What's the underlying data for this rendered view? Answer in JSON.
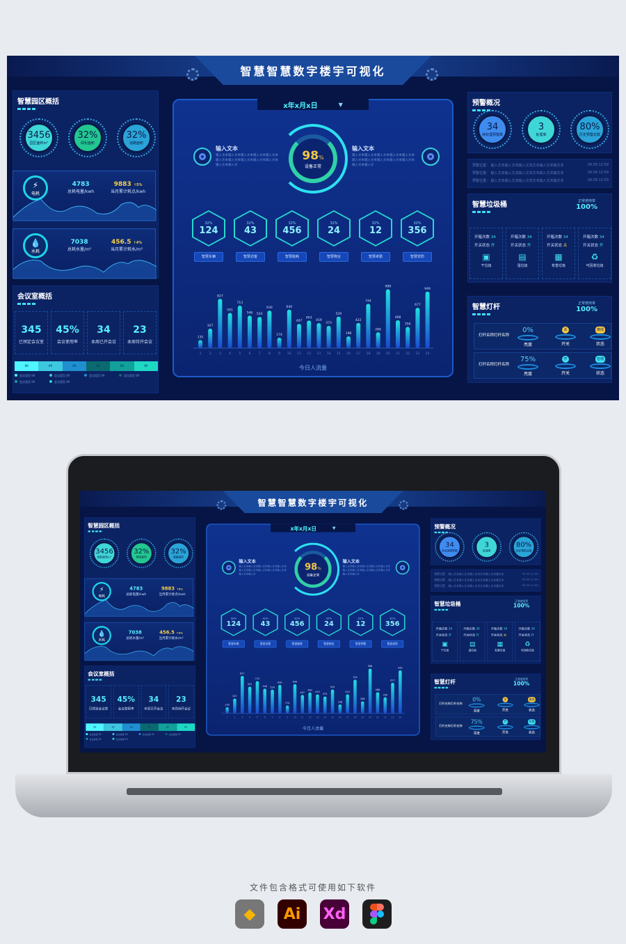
{
  "header": {
    "title": "智慧智慧数字楼宇可视化"
  },
  "park": {
    "title": "智慧园区概括",
    "circles": [
      {
        "value": "3456",
        "label": "园区面积m²",
        "color": "#3fd6d8"
      },
      {
        "value": "32%",
        "label": "绿化面积",
        "color": "#22c890"
      },
      {
        "value": "32%",
        "label": "道路面积",
        "color": "#2aa4d8"
      }
    ],
    "electric": {
      "icon_label": "电耗",
      "total": "4783",
      "total_label": "总耗电量/kwh",
      "month": "9883",
      "month_trend": "↑5%",
      "month_label": "当月累计耗点/kwh"
    },
    "water": {
      "icon_label": "水耗",
      "total": "7038",
      "total_label": "总耗水量/m²",
      "month": "456.5",
      "month_trend": "↑4%",
      "month_label": "当月累计耗水/m²"
    }
  },
  "meeting": {
    "title": "会议室概括",
    "stats": [
      {
        "value": "345",
        "label": "已预定会议室"
      },
      {
        "value": "45%",
        "label": "会议使用率"
      },
      {
        "value": "34",
        "label": "本周已开会议"
      },
      {
        "value": "23",
        "label": "本周待开会议"
      }
    ],
    "segments": [
      {
        "label": "89",
        "color": "#4ff5ff"
      },
      {
        "label": "89",
        "color": "#3ec8e0"
      },
      {
        "label": "89",
        "color": "#1f8fd0"
      },
      {
        "label": "89",
        "color": "#0a6a70"
      },
      {
        "label": "89",
        "color": "#11a09a"
      },
      {
        "label": "89",
        "color": "#1ed8c4"
      }
    ],
    "legend": [
      "会议类型 89",
      "会议类型 89",
      "会议类型 89",
      "会议类型 89",
      "会议类型 89",
      "会议类型 89"
    ]
  },
  "center": {
    "date": "x年x月x日",
    "gauge": {
      "value": "98",
      "unit": "%",
      "label": "设备正常",
      "percent": 98
    },
    "left_info": {
      "title": "输入文本",
      "text": "输入文本输入文本输入文本输入文本输入文本输入文本输入文本输入文本输入文本输入文本输入文本输入文"
    },
    "right_info": {
      "title": "输入文本",
      "text": "输入文本输入文本输入文本输入文本输入文本输入文本输入文本输入文本输入文本输入文本输入文本输入文"
    },
    "hexes": [
      {
        "pct": "32%",
        "value": "124",
        "label": "智慧车辆"
      },
      {
        "pct": "32%",
        "value": "43",
        "label": "智慧访客"
      },
      {
        "pct": "32%",
        "value": "456",
        "label": "智慧能耗"
      },
      {
        "pct": "32%",
        "value": "24",
        "label": "智慧物业"
      },
      {
        "pct": "32%",
        "value": "12",
        "label": "智慧考勤"
      },
      {
        "pct": "32%",
        "value": "356",
        "label": "智慧安防"
      }
    ]
  },
  "chart_data": {
    "type": "bar",
    "title": "今日人流量",
    "categories": [
      "1",
      "2",
      "3",
      "4",
      "5",
      "6",
      "7",
      "8",
      "9",
      "10",
      "11",
      "12",
      "13",
      "14",
      "15",
      "16",
      "17",
      "18",
      "19",
      "20",
      "21",
      "22",
      "23",
      "24"
    ],
    "values": [
      135,
      327,
      827,
      591,
      713,
      546,
      524,
      630,
      174,
      646,
      407,
      463,
      419,
      373,
      529,
      198,
      422,
      744,
      266,
      988,
      468,
      356,
      677,
      949
    ],
    "ylim": [
      0,
      1000
    ],
    "grid": false
  },
  "warning": {
    "title": "预警概况",
    "circles": [
      {
        "value": "34",
        "label": "待处理预警数",
        "color": "#3f8cf0"
      },
      {
        "value": "3",
        "label": "处理率",
        "color": "#3fd6d8"
      },
      {
        "value": "80%",
        "label": "历史预警总数",
        "color": "#2aa4d8"
      }
    ],
    "items": [
      {
        "text": "预警位置：  输入文本输入文本输入文本文本输入文本输文本",
        "time": "09.09 12:59"
      },
      {
        "text": "预警位置：  输入文本输入文本输入文本文本输入文本输文本",
        "time": "09.09 12:59"
      },
      {
        "text": "预警位置：  输入文本输入文本输入文本文本输入文本输文本",
        "time": "09.09 12:59"
      }
    ]
  },
  "trash": {
    "title": "智慧垃圾桶",
    "rate_label": "正常使用率",
    "rate": "100%",
    "open_label": "开箱次数",
    "state_label": "开关状态",
    "bins": [
      {
        "count": "34",
        "state": "开",
        "name": "干垃圾",
        "icon": "dry-trash-icon"
      },
      {
        "count": "34",
        "state": "开",
        "name": "湿垃圾",
        "icon": "wet-trash-icon"
      },
      {
        "count": "34",
        "state": "关",
        "name": "有害垃圾",
        "icon": "hazard-trash-icon"
      },
      {
        "count": "34",
        "state": "开",
        "name": "可回收垃圾",
        "icon": "recycle-icon"
      }
    ]
  },
  "lamp": {
    "title": "智慧灯杆",
    "rate_label": "正常使用率",
    "rate": "100%",
    "brightness_label": "亮度",
    "switch_label": "开关",
    "status_label": "状态",
    "rows": [
      {
        "name": "灯杆名称灯杆名称",
        "brightness": "0%",
        "switch": "关",
        "status": "离线",
        "color": "#f5c842"
      },
      {
        "name": "灯杆名称灯杆名称",
        "brightness": "75%",
        "switch": "开",
        "status": "在线",
        "color": "#3ee0f0"
      }
    ]
  },
  "footer": {
    "label": "文件包含格式可使用如下软件",
    "apps": [
      {
        "name": "Sketch",
        "icon": "sketch-icon"
      },
      {
        "name": "Ai",
        "icon": "illustrator-icon"
      },
      {
        "name": "Xd",
        "icon": "xd-icon"
      },
      {
        "name": "Figma",
        "icon": "figma-icon"
      }
    ]
  }
}
